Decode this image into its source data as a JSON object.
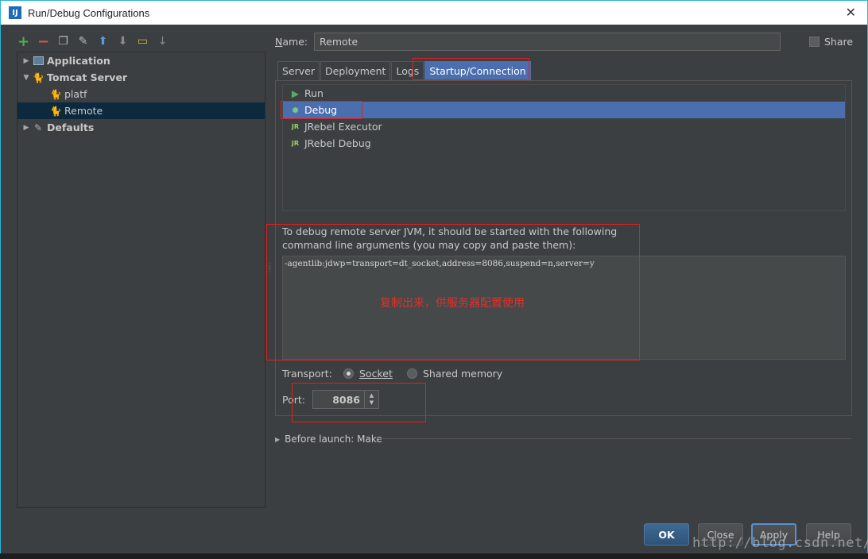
{
  "window": {
    "title": "Run/Debug Configurations",
    "app_icon": "IJ",
    "close_glyph": "✕"
  },
  "toolbar": {
    "icons": [
      "add-icon",
      "remove-icon",
      "copy-icon",
      "wrench-icon",
      "arrow-up-icon",
      "arrow-down-icon",
      "folder-icon",
      "sort-icon"
    ]
  },
  "tree": {
    "items": [
      {
        "label": "Application",
        "bold": true
      },
      {
        "label": "Tomcat Server",
        "bold": true
      },
      {
        "label": "platf"
      },
      {
        "label": "Remote",
        "selected": true
      },
      {
        "label": "Defaults",
        "bold": true
      }
    ]
  },
  "form": {
    "name_label_prefix": "N",
    "name_label_rest": "ame:",
    "name_value": "Remote",
    "share_label": "Share"
  },
  "tabs": [
    {
      "label": "Server"
    },
    {
      "label": "Deployment"
    },
    {
      "label": "Logs"
    },
    {
      "label": "Startup/Connection",
      "active": true
    }
  ],
  "startup": {
    "items": [
      {
        "label": "Run"
      },
      {
        "label": "Debug",
        "selected": true
      },
      {
        "label": "JRebel Executor"
      },
      {
        "label": "JRebel Debug"
      }
    ],
    "description": "To debug remote server JVM, it should be started with the following command line arguments (you may copy and paste them):",
    "command": "-agentlib:jdwp=transport=dt_socket,address=8086,suspend=n,server=y",
    "annotation": "复制出来，供服务器配置使用",
    "transport_label": "Transport:",
    "transport_socket": "Socket",
    "transport_shared": "Shared memory",
    "port_label": "Port:",
    "port_value": "8086"
  },
  "before_launch": "Before launch: Make",
  "buttons": {
    "ok": "OK",
    "close": "Close",
    "apply": "Apply",
    "help": "Help"
  },
  "watermark": "http://blog.csdn.net/",
  "colors": {
    "accent": "#4b6eaf",
    "annotation_red": "#e02020",
    "background": "#3c3f41"
  }
}
